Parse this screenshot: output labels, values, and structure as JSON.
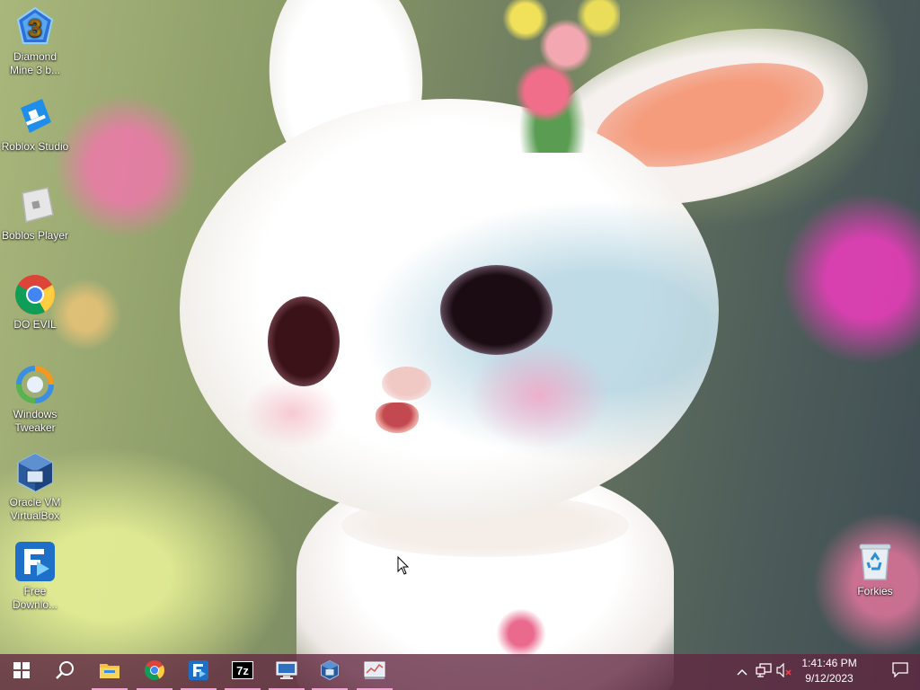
{
  "desktop": {
    "icons": [
      {
        "label": "Diamond Mine 3 b...",
        "icon": "diamond-mine-icon"
      },
      {
        "label": "Roblox Studio",
        "icon": "roblox-studio-icon"
      },
      {
        "label": "Boblos Player",
        "icon": "roblox-player-icon"
      },
      {
        "label": "DO EVIL",
        "icon": "chrome-icon"
      },
      {
        "label": "Windows Tweaker",
        "icon": "windows-tweaker-icon"
      },
      {
        "label": "Oracle VM VirtualBox",
        "icon": "virtualbox-icon"
      },
      {
        "label": "Free Downlo...",
        "icon": "free-download-manager-icon"
      },
      {
        "label": "Forkies",
        "icon": "recycle-bin-icon"
      }
    ]
  },
  "taskbar": {
    "pinned": [
      {
        "name": "start",
        "icon": "windows-logo-icon",
        "running": false
      },
      {
        "name": "search",
        "icon": "search-icon",
        "running": false
      },
      {
        "name": "file-explorer",
        "icon": "folder-icon",
        "running": true
      },
      {
        "name": "chrome",
        "icon": "chrome-icon",
        "running": true
      },
      {
        "name": "free-download-manager",
        "icon": "free-download-manager-icon",
        "running": true
      },
      {
        "name": "7zip",
        "icon": "7zip-icon",
        "running": true
      },
      {
        "name": "display-app",
        "icon": "monitor-icon",
        "running": true
      },
      {
        "name": "virtualbox",
        "icon": "virtualbox-icon",
        "running": true
      },
      {
        "name": "windows-tweaker",
        "icon": "system-tool-icon",
        "running": true
      }
    ],
    "tray": {
      "time": "1:41:46 PM",
      "date": "9/12/2023",
      "icons": [
        "chevron-up-icon",
        "network-icon",
        "volume-muted-icon",
        "notification-icon"
      ]
    },
    "accent_color": "#f2a7d2",
    "background_color": "#622640"
  }
}
